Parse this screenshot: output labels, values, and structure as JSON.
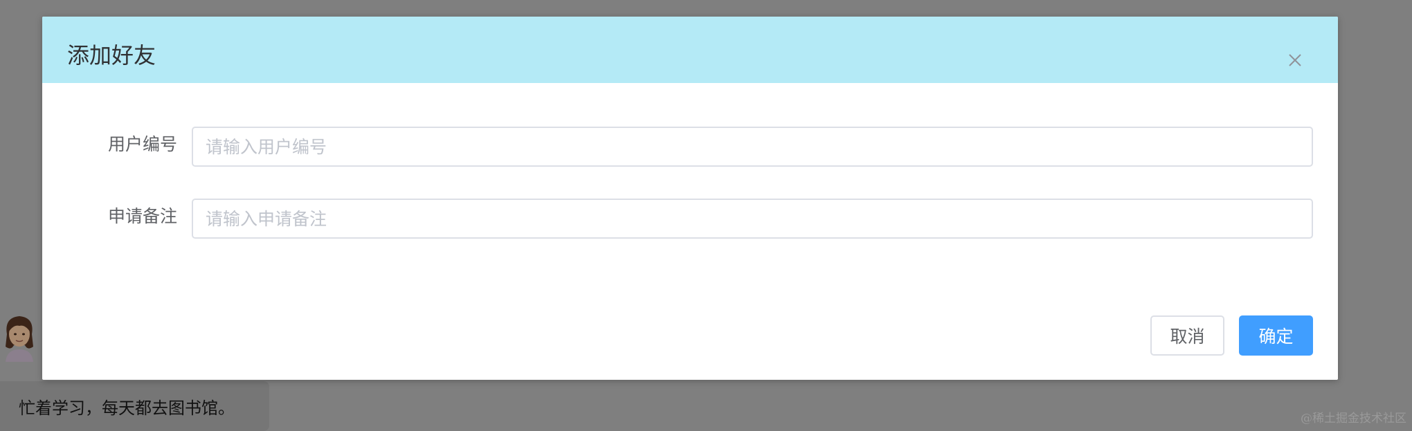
{
  "background": {
    "status_text": "忙着学习，每天都去图书馆。",
    "watermark": "@稀土掘金技术社区"
  },
  "dialog": {
    "title": "添加好友",
    "close_icon": "close-icon",
    "fields": [
      {
        "label": "用户编号",
        "value": "",
        "placeholder": "请输入用户编号"
      },
      {
        "label": "申请备注",
        "value": "",
        "placeholder": "请输入申请备注"
      }
    ],
    "cancel_label": "取消",
    "confirm_label": "确定"
  },
  "colors": {
    "overlay": "#7f7f7f",
    "header_bg": "#b4eaf6",
    "primary": "#409eff",
    "border": "#dcdfe6",
    "placeholder": "#c0c4cc",
    "text": "#606266",
    "title": "#303133"
  }
}
